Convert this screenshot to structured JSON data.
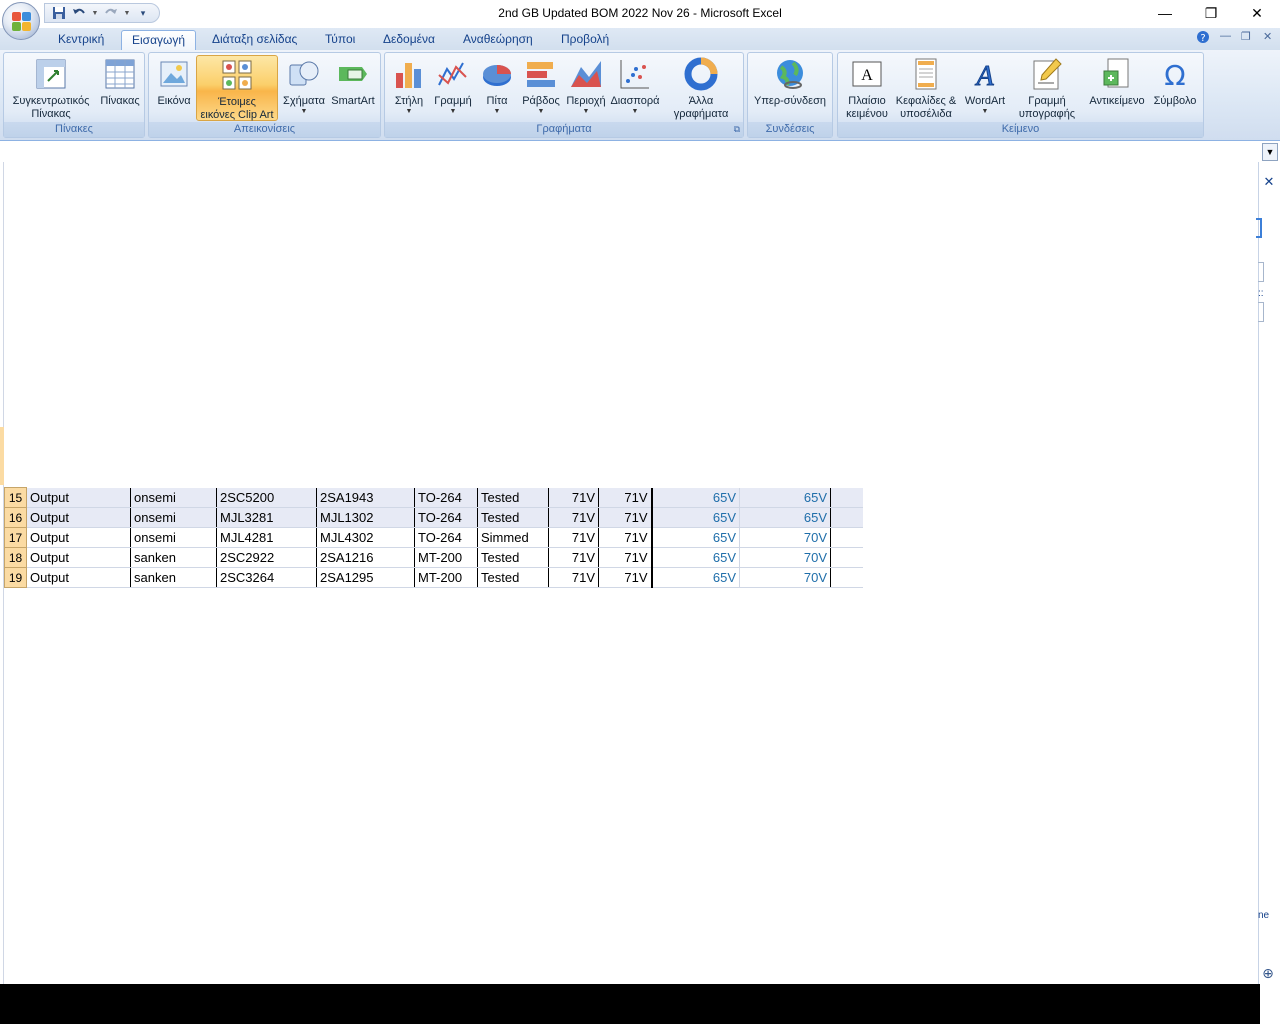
{
  "window": {
    "title": "2nd GB Updated BOM 2022 Nov 26 - Microsoft Excel",
    "minimize": "—",
    "restore": "❐",
    "close": "✕"
  },
  "quick_access": {
    "save_icon": "save-icon",
    "undo_icon": "undo-icon",
    "redo_icon": "redo-icon",
    "customize_icon": "customize-icon"
  },
  "tabs": [
    {
      "label": "Κεντρική"
    },
    {
      "label": "Εισαγωγή"
    },
    {
      "label": "Διάταξη σελίδας"
    },
    {
      "label": "Τύποι"
    },
    {
      "label": "Δεδομένα"
    },
    {
      "label": "Αναθεώρηση"
    },
    {
      "label": "Προβολή"
    }
  ],
  "active_tab": "Εισαγωγή",
  "ribbon": {
    "groups": {
      "tables": {
        "label": "Πίνακες",
        "pivot_line1": "Συγκεντρωτικός",
        "pivot_line2": "Πίνακας",
        "table": "Πίνακας"
      },
      "illustrations": {
        "label": "Απεικονίσεις",
        "picture": "Εικόνα",
        "clipart_line1": "Έτοιμες",
        "clipart_line2": "εικόνες Clip Art",
        "shapes": "Σχήματα",
        "smartart": "SmartArt"
      },
      "charts": {
        "label": "Γραφήματα",
        "column": "Στήλη",
        "line": "Γραμμή",
        "pie": "Πίτα",
        "bar": "Ράβδος",
        "area": "Περιοχή",
        "scatter": "Διασπορά",
        "other_line1": "Άλλα",
        "other_line2": "γραφήματα"
      },
      "links": {
        "label": "Συνδέσεις",
        "hyperlink": "Υπερ-σύνδεση"
      },
      "text": {
        "label": "Κείμενο",
        "textbox_line1": "Πλαίσιο",
        "textbox_line2": "κειμένου",
        "header_line1": "Κεφαλίδες &",
        "header_line2": "υποσέλιδα",
        "wordart": "WordArt",
        "signature_line1": "Γραμμή",
        "signature_line2": "υπογραφής",
        "object": "Αντικείμενο",
        "symbol": "Σύμβολο"
      }
    }
  },
  "task_pane": {
    "close": "✕",
    "partial_text": "ne",
    "partial_label": "::"
  },
  "sheet": {
    "rows": [
      {
        "num": "15",
        "cells": [
          "Output",
          "onsemi",
          "2SC5200",
          "2SA1943",
          "TO-264",
          "Tested",
          "71V",
          "71V",
          "65V",
          "65V"
        ]
      },
      {
        "num": "16",
        "cells": [
          "Output",
          "onsemi",
          "MJL3281",
          "MJL1302",
          "TO-264",
          "Tested",
          "71V",
          "71V",
          "65V",
          "65V"
        ]
      },
      {
        "num": "17",
        "cells": [
          "Output",
          "onsemi",
          "MJL4281",
          "MJL4302",
          "TO-264",
          "Simmed",
          "71V",
          "71V",
          "65V",
          "70V"
        ]
      },
      {
        "num": "18",
        "cells": [
          "Output",
          "sanken",
          "2SC2922",
          "2SA1216",
          "MT-200",
          "Tested",
          "71V",
          "71V",
          "65V",
          "70V"
        ]
      },
      {
        "num": "19",
        "cells": [
          "Output",
          "sanken",
          "2SC3264",
          "2SA1295",
          "MT-200",
          "Tested",
          "71V",
          "71V",
          "65V",
          "70V"
        ]
      }
    ]
  },
  "colors": {
    "ribbon_accent": "#15428b",
    "row_header": "#fbdba3",
    "value_blue": "#1f6eaa",
    "selected_row": "#e7eaf5"
  }
}
